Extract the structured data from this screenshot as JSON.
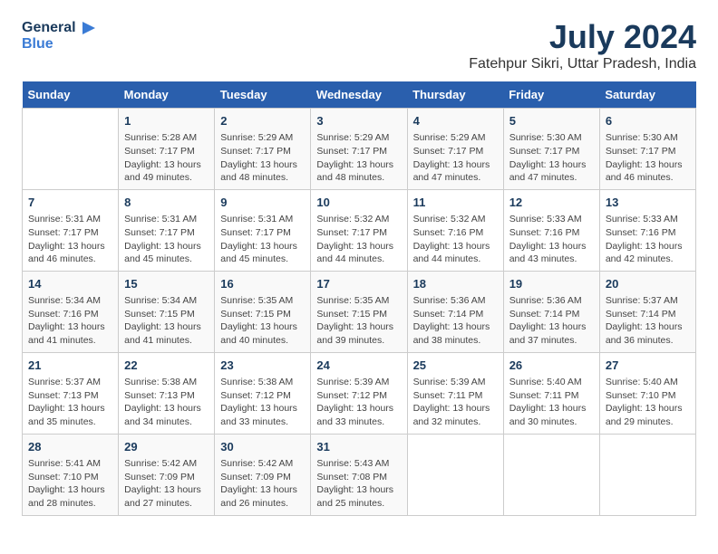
{
  "logo": {
    "line1": "General",
    "line2": "Blue"
  },
  "title": "July 2024",
  "subtitle": "Fatehpur Sikri, Uttar Pradesh, India",
  "days_of_week": [
    "Sunday",
    "Monday",
    "Tuesday",
    "Wednesday",
    "Thursday",
    "Friday",
    "Saturday"
  ],
  "weeks": [
    [
      {
        "day": "",
        "info": ""
      },
      {
        "day": "1",
        "info": "Sunrise: 5:28 AM\nSunset: 7:17 PM\nDaylight: 13 hours\nand 49 minutes."
      },
      {
        "day": "2",
        "info": "Sunrise: 5:29 AM\nSunset: 7:17 PM\nDaylight: 13 hours\nand 48 minutes."
      },
      {
        "day": "3",
        "info": "Sunrise: 5:29 AM\nSunset: 7:17 PM\nDaylight: 13 hours\nand 48 minutes."
      },
      {
        "day": "4",
        "info": "Sunrise: 5:29 AM\nSunset: 7:17 PM\nDaylight: 13 hours\nand 47 minutes."
      },
      {
        "day": "5",
        "info": "Sunrise: 5:30 AM\nSunset: 7:17 PM\nDaylight: 13 hours\nand 47 minutes."
      },
      {
        "day": "6",
        "info": "Sunrise: 5:30 AM\nSunset: 7:17 PM\nDaylight: 13 hours\nand 46 minutes."
      }
    ],
    [
      {
        "day": "7",
        "info": "Sunrise: 5:31 AM\nSunset: 7:17 PM\nDaylight: 13 hours\nand 46 minutes."
      },
      {
        "day": "8",
        "info": "Sunrise: 5:31 AM\nSunset: 7:17 PM\nDaylight: 13 hours\nand 45 minutes."
      },
      {
        "day": "9",
        "info": "Sunrise: 5:31 AM\nSunset: 7:17 PM\nDaylight: 13 hours\nand 45 minutes."
      },
      {
        "day": "10",
        "info": "Sunrise: 5:32 AM\nSunset: 7:17 PM\nDaylight: 13 hours\nand 44 minutes."
      },
      {
        "day": "11",
        "info": "Sunrise: 5:32 AM\nSunset: 7:16 PM\nDaylight: 13 hours\nand 44 minutes."
      },
      {
        "day": "12",
        "info": "Sunrise: 5:33 AM\nSunset: 7:16 PM\nDaylight: 13 hours\nand 43 minutes."
      },
      {
        "day": "13",
        "info": "Sunrise: 5:33 AM\nSunset: 7:16 PM\nDaylight: 13 hours\nand 42 minutes."
      }
    ],
    [
      {
        "day": "14",
        "info": "Sunrise: 5:34 AM\nSunset: 7:16 PM\nDaylight: 13 hours\nand 41 minutes."
      },
      {
        "day": "15",
        "info": "Sunrise: 5:34 AM\nSunset: 7:15 PM\nDaylight: 13 hours\nand 41 minutes."
      },
      {
        "day": "16",
        "info": "Sunrise: 5:35 AM\nSunset: 7:15 PM\nDaylight: 13 hours\nand 40 minutes."
      },
      {
        "day": "17",
        "info": "Sunrise: 5:35 AM\nSunset: 7:15 PM\nDaylight: 13 hours\nand 39 minutes."
      },
      {
        "day": "18",
        "info": "Sunrise: 5:36 AM\nSunset: 7:14 PM\nDaylight: 13 hours\nand 38 minutes."
      },
      {
        "day": "19",
        "info": "Sunrise: 5:36 AM\nSunset: 7:14 PM\nDaylight: 13 hours\nand 37 minutes."
      },
      {
        "day": "20",
        "info": "Sunrise: 5:37 AM\nSunset: 7:14 PM\nDaylight: 13 hours\nand 36 minutes."
      }
    ],
    [
      {
        "day": "21",
        "info": "Sunrise: 5:37 AM\nSunset: 7:13 PM\nDaylight: 13 hours\nand 35 minutes."
      },
      {
        "day": "22",
        "info": "Sunrise: 5:38 AM\nSunset: 7:13 PM\nDaylight: 13 hours\nand 34 minutes."
      },
      {
        "day": "23",
        "info": "Sunrise: 5:38 AM\nSunset: 7:12 PM\nDaylight: 13 hours\nand 33 minutes."
      },
      {
        "day": "24",
        "info": "Sunrise: 5:39 AM\nSunset: 7:12 PM\nDaylight: 13 hours\nand 33 minutes."
      },
      {
        "day": "25",
        "info": "Sunrise: 5:39 AM\nSunset: 7:11 PM\nDaylight: 13 hours\nand 32 minutes."
      },
      {
        "day": "26",
        "info": "Sunrise: 5:40 AM\nSunset: 7:11 PM\nDaylight: 13 hours\nand 30 minutes."
      },
      {
        "day": "27",
        "info": "Sunrise: 5:40 AM\nSunset: 7:10 PM\nDaylight: 13 hours\nand 29 minutes."
      }
    ],
    [
      {
        "day": "28",
        "info": "Sunrise: 5:41 AM\nSunset: 7:10 PM\nDaylight: 13 hours\nand 28 minutes."
      },
      {
        "day": "29",
        "info": "Sunrise: 5:42 AM\nSunset: 7:09 PM\nDaylight: 13 hours\nand 27 minutes."
      },
      {
        "day": "30",
        "info": "Sunrise: 5:42 AM\nSunset: 7:09 PM\nDaylight: 13 hours\nand 26 minutes."
      },
      {
        "day": "31",
        "info": "Sunrise: 5:43 AM\nSunset: 7:08 PM\nDaylight: 13 hours\nand 25 minutes."
      },
      {
        "day": "",
        "info": ""
      },
      {
        "day": "",
        "info": ""
      },
      {
        "day": "",
        "info": ""
      }
    ]
  ]
}
